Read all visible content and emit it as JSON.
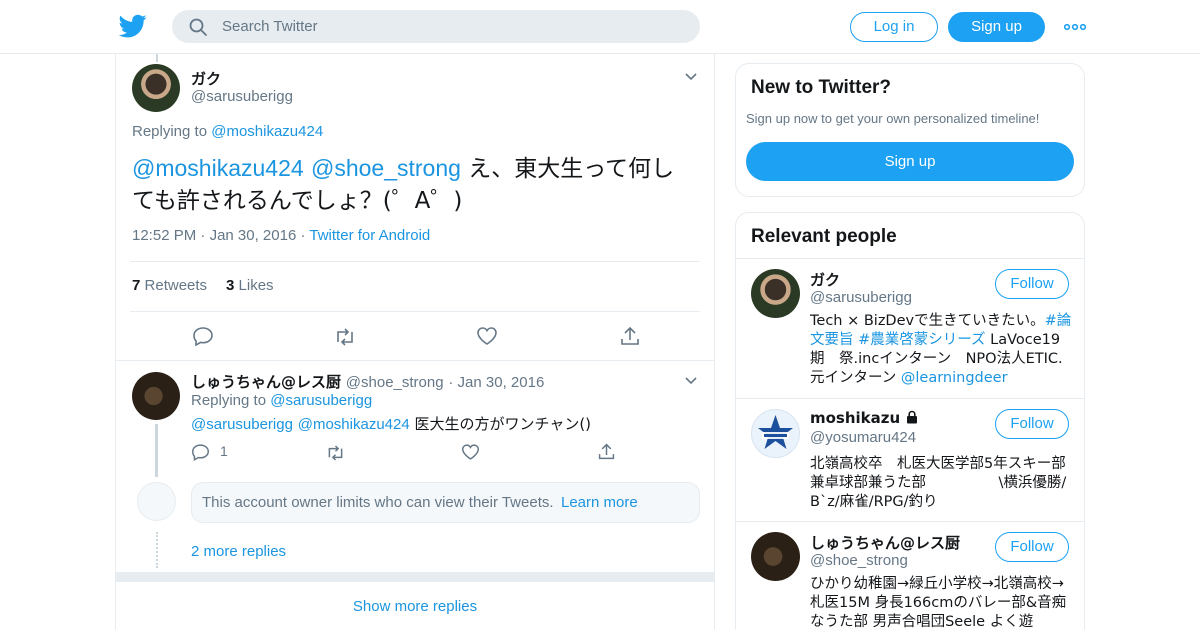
{
  "header": {
    "search_placeholder": "Search Twitter",
    "login_label": "Log in",
    "signup_label": "Sign up",
    "more_icon": "more-dots-icon",
    "brand_color": "#1da1f2"
  },
  "main_tweet": {
    "display_name": "ガク",
    "handle": "@sarusuberigg",
    "replying_prefix": "Replying to",
    "replying_to": "@moshikazu424",
    "mention1": "@moshikazu424",
    "mention2": "@shoe_strong",
    "text_line1": "え、東大生って何し",
    "text_line2": "ても許されるんでしょ？(゜A゜)",
    "time": "12:52 PM",
    "date": "Jan 30, 2016",
    "source": "Twitter for Android",
    "retweets_count": "7",
    "retweets_label": "Retweets",
    "likes_count": "3",
    "likes_label": "Likes"
  },
  "reply_tweet": {
    "display_name": "しゅうちゃん@レス厨",
    "handle": "@shoe_strong",
    "date": "Jan 30, 2016",
    "replying_prefix": "Replying to",
    "replying_to": "@sarusuberigg",
    "mention1": "@sarusuberigg",
    "mention2": "@moshikazu424",
    "text": "医大生の方がワンチャン()",
    "reply_count": "1"
  },
  "protected_notice": {
    "text": "This account owner limits who can view their Tweets.",
    "link": "Learn more"
  },
  "more_replies": "2 more replies",
  "show_more_replies": "Show more replies",
  "new_to_twitter": {
    "title": "New to Twitter?",
    "subtitle": "Sign up now to get your own personalized timeline!",
    "button": "Sign up"
  },
  "relevant_people": {
    "title": "Relevant people",
    "follow_label": "Follow",
    "people": [
      {
        "name": "ガク",
        "handle": "@sarusuberigg",
        "bio_a": "Tech × BizDevで生きていきたい。",
        "bio_tag1": "#論文要旨",
        "bio_b": " ",
        "bio_tag2": "#農業啓蒙シリーズ",
        "bio_c": " LaVoce19期　祭.incインターン　NPO法人ETIC.元インターン ",
        "bio_link": "@learningdeer"
      },
      {
        "name": "moshikazu",
        "handle": "@yosumaru424",
        "bio": "北嶺高校卒　札医大医学部5年スキー部兼卓球部兼うた部　　　　　\\横浜優勝/　　　B`z/麻雀/RPG/釣り"
      },
      {
        "name": "しゅうちゃん@レス厨",
        "handle": "@shoe_strong",
        "bio": "ひかり幼稚園→緑丘小学校→北嶺高校→札医15M 身長166cmのバレー部&音痴なうた部 男声合唱団Seele よく遊"
      }
    ]
  }
}
